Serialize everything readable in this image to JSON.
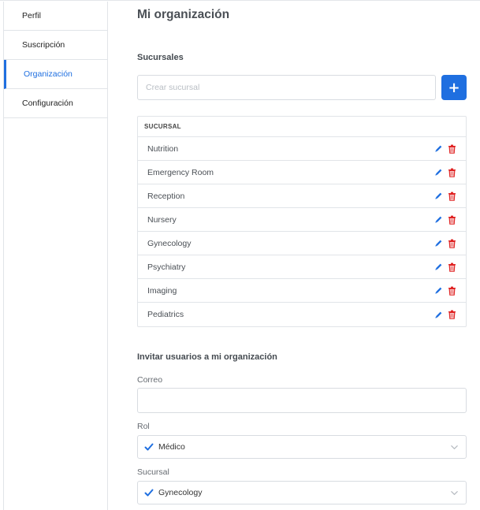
{
  "sidebar": {
    "items": [
      {
        "label": "Perfil",
        "active": false
      },
      {
        "label": "Suscripción",
        "active": false
      },
      {
        "label": "Organización",
        "active": true
      },
      {
        "label": "Configuración",
        "active": false
      }
    ]
  },
  "main": {
    "title": "Mi organización",
    "branches_section": {
      "heading": "Sucursales",
      "create_placeholder": "Crear sucursal",
      "add_button_label": "+",
      "table_header": "SUCURSAL",
      "rows": [
        "Nutrition",
        "Emergency Room",
        "Reception",
        "Nursery",
        "Gynecology",
        "Psychiatry",
        "Imaging",
        "Pediatrics"
      ]
    },
    "invite_section": {
      "heading": "Invitar usuarios a mi organización",
      "email_label": "Correo",
      "email_value": "",
      "role_label": "Rol",
      "role_value": "Médico",
      "branch_label": "Sucursal",
      "branch_value": "Gynecology"
    }
  },
  "colors": {
    "accent": "#1f6fe0",
    "delete": "#e02424",
    "border": "#e1e4e8"
  },
  "icons": {
    "edit": "pencil-icon",
    "delete": "trash-icon",
    "selected": "check-icon",
    "dropdown": "chevron-down-icon"
  }
}
